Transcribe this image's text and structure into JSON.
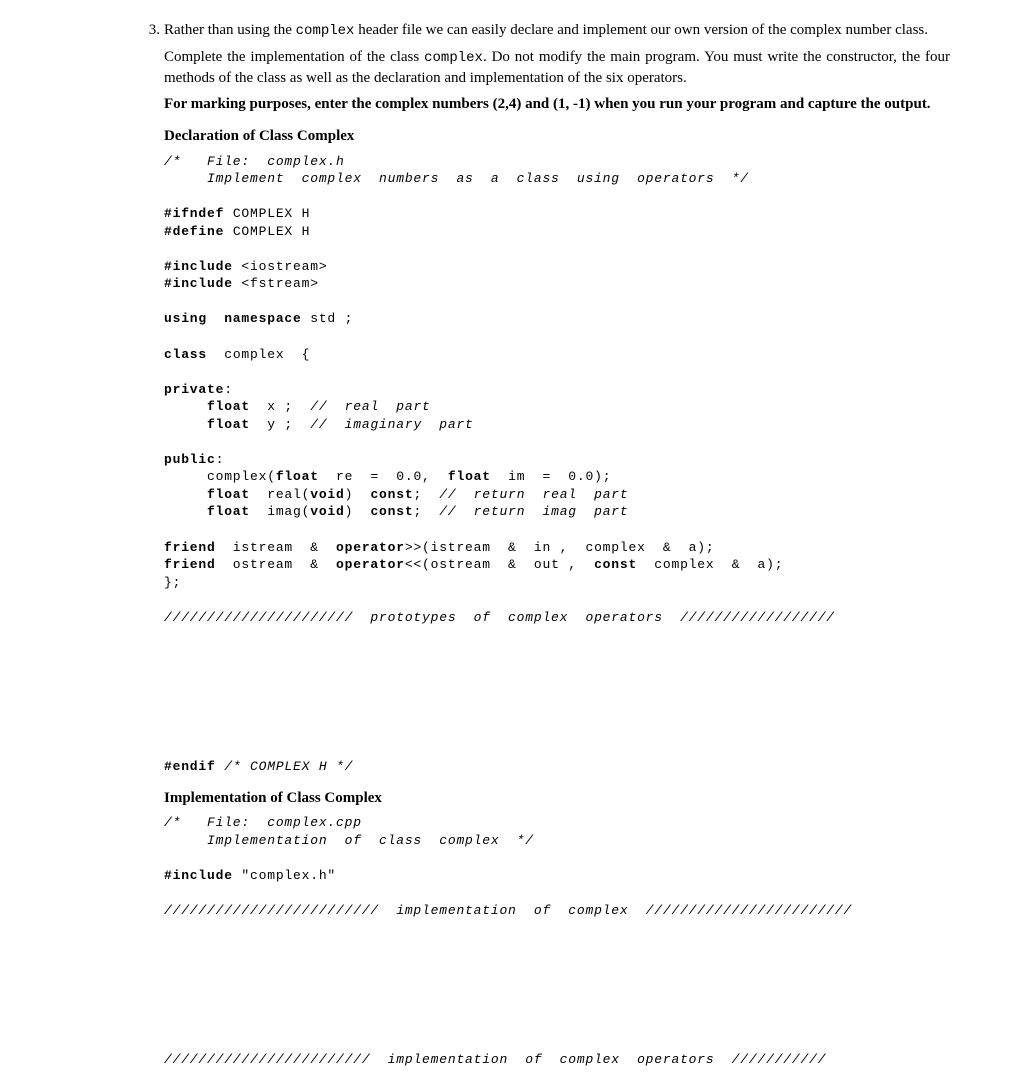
{
  "item_number": "3.",
  "para1_a": "Rather than using the ",
  "para1_code": "complex",
  "para1_b": " header file we can easily declare and implement our own version of the complex number class.",
  "para2_a": "Complete the implementation of the class ",
  "para2_code": "complex",
  "para2_b": ". Do not modify the main program. You must write the constructor, the four methods of the class as well as the declaration and implementation of the six operators.",
  "para3": "For marking purposes, enter the complex numbers (2,4) and (1, -1) when you run your program and capture the output.",
  "sect1": "Declaration of Class Complex",
  "code1": {
    "l1": "/*   File:  complex.h",
    "l2": "     Implement  complex  numbers  as  a  class  using  operators  */",
    "l3": "#ifndef",
    "l3b": " COMPLEX H",
    "l4": "#define",
    "l4b": " COMPLEX H",
    "l5": "#include",
    "l5b": " <iostream>",
    "l6": "#include",
    "l6b": " <fstream>",
    "l7": "using  namespace",
    "l7b": " std ;",
    "l8": "class",
    "l8b": "  complex  {",
    "l9": "private",
    "l9b": ":",
    "l10": "     float",
    "l10b": "  x ;  ",
    "l10c": "//  real  part",
    "l11": "     float",
    "l11b": "  y ;  ",
    "l11c": "//  imaginary  part",
    "l12": "public",
    "l12b": ":",
    "l13a": "     complex(",
    "l13b": "float",
    "l13c": "  re  =  0.0,  ",
    "l13d": "float",
    "l13e": "  im  =  0.0);",
    "l14a": "     float",
    "l14b": "  real(",
    "l14c": "void",
    "l14d": ")  ",
    "l14e": "const",
    "l14f": ";  ",
    "l14g": "//  return  real  part",
    "l15a": "     float",
    "l15b": "  imag(",
    "l15c": "void",
    "l15d": ")  ",
    "l15e": "const",
    "l15f": ";  ",
    "l15g": "//  return  imag  part",
    "l16a": "friend",
    "l16b": "  istream  &  ",
    "l16c": "operator",
    "l16d": ">>(istream  &  in ,  complex  &  a);",
    "l17a": "friend",
    "l17b": "  ostream  &  ",
    "l17c": "operator",
    "l17d": "<<(ostream  &  out ,  ",
    "l17e": "const",
    "l17f": "  complex  &  a);",
    "l18": "};",
    "l19": "//////////////////////  prototypes  of  complex  operators  //////////////////",
    "l20a": "#endif",
    "l20b": " ",
    "l20c": "/* COMPLEX H */"
  },
  "sect2": "Implementation of Class Complex",
  "code2": {
    "l1": "/*   File:  complex.cpp",
    "l2": "     Implementation  of  class  complex  */",
    "l3a": "#include",
    "l3b": " \"complex.h\"",
    "l4": "/////////////////////////  implementation  of  complex  ////////////////////////",
    "l5": "////////////////////////  implementation  of  complex  operators  ///////////"
  }
}
